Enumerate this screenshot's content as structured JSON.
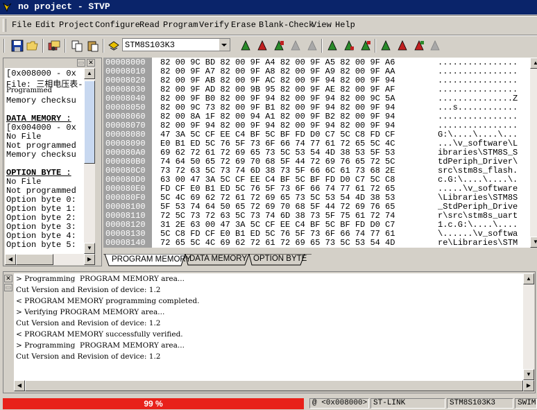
{
  "window": {
    "title": "no project - STVP"
  },
  "menu": [
    "File",
    "Edit",
    "Project",
    "Configure",
    "Read",
    "Program",
    "Verify",
    "Erase",
    "Blank-Check",
    "View",
    "Help"
  ],
  "toolbar": {
    "device": "STM8S103K3"
  },
  "info_panel": {
    "lines": [
      {
        "text": "[0x008000 - 0x",
        "kind": "normal"
      },
      {
        "text": "File: 三相电压表-",
        "kind": "normal"
      },
      {
        "text": "Programmed",
        "kind": "small"
      },
      {
        "text": "Memory checksu",
        "kind": "normal"
      },
      {
        "text": "",
        "kind": "blank"
      },
      {
        "text": "DATA MEMORY :",
        "kind": "header"
      },
      {
        "text": "[0x004000 - 0x",
        "kind": "normal"
      },
      {
        "text": "No File",
        "kind": "normal"
      },
      {
        "text": "Not programmed",
        "kind": "normal"
      },
      {
        "text": "Memory checksu",
        "kind": "normal"
      },
      {
        "text": "",
        "kind": "blank"
      },
      {
        "text": "OPTION BYTE :",
        "kind": "header"
      },
      {
        "text": "No File",
        "kind": "normal"
      },
      {
        "text": "Not programmed",
        "kind": "normal"
      },
      {
        "text": "Option byte 0:",
        "kind": "normal"
      },
      {
        "text": "Option byte 1:",
        "kind": "normal"
      },
      {
        "text": "Option byte 2:",
        "kind": "normal"
      },
      {
        "text": "Option byte 3:",
        "kind": "normal"
      },
      {
        "text": "Option byte 4:",
        "kind": "normal"
      },
      {
        "text": "Option byte 5:",
        "kind": "normal"
      }
    ]
  },
  "memory": {
    "rows": [
      {
        "addr": "00008000",
        "bytes": "82 00 9C BD 82 00 9F A4 82 00 9F A5 82 00 9F A6",
        "ascii": "................"
      },
      {
        "addr": "00008010",
        "bytes": "82 00 9F A7 82 00 9F A8 82 00 9F A9 82 00 9F AA",
        "ascii": "................"
      },
      {
        "addr": "00008020",
        "bytes": "82 00 9F AB 82 00 9F AC 82 00 9F 94 82 00 9F 94",
        "ascii": "................"
      },
      {
        "addr": "00008030",
        "bytes": "82 00 9F AD 82 00 9B 95 82 00 9F AE 82 00 9F AF",
        "ascii": "................"
      },
      {
        "addr": "00008040",
        "bytes": "82 00 9F B0 82 00 9F 94 82 00 9F 94 82 00 9C 5A",
        "ascii": "...............Z"
      },
      {
        "addr": "00008050",
        "bytes": "82 00 9C 73 82 00 9F B1 82 00 9F 94 82 00 9F 94",
        "ascii": "...s............"
      },
      {
        "addr": "00008060",
        "bytes": "82 00 8A 1F 82 00 94 A1 82 00 9F B2 82 00 9F 94",
        "ascii": "................"
      },
      {
        "addr": "00008070",
        "bytes": "82 00 9F 94 82 00 9F 94 82 00 9F 94 82 00 9F 94",
        "ascii": "................"
      },
      {
        "addr": "00008080",
        "bytes": "47 3A 5C CF EE C4 BF 5C BF FD D0 C7 5C C8 FD CF",
        "ascii": "G:\\....\\....\\..."
      },
      {
        "addr": "00008090",
        "bytes": "E0 B1 ED 5C 76 5F 73 6F 66 74 77 61 72 65 5C 4C",
        "ascii": "...\\v_software\\L"
      },
      {
        "addr": "000080A0",
        "bytes": "69 62 72 61 72 69 65 73 5C 53 54 4D 38 53 5F 53",
        "ascii": "ibraries\\STM8S_S"
      },
      {
        "addr": "000080B0",
        "bytes": "74 64 50 65 72 69 70 68 5F 44 72 69 76 65 72 5C",
        "ascii": "tdPeriph_Driver\\"
      },
      {
        "addr": "000080C0",
        "bytes": "73 72 63 5C 73 74 6D 38 73 5F 66 6C 61 73 68 2E",
        "ascii": "src\\stm8s_flash."
      },
      {
        "addr": "000080D0",
        "bytes": "63 00 47 3A 5C CF EE C4 BF 5C BF FD D0 C7 5C C8",
        "ascii": "c.G:\\....\\....\\."
      },
      {
        "addr": "000080E0",
        "bytes": "FD CF E0 B1 ED 5C 76 5F 73 6F 66 74 77 61 72 65",
        "ascii": ".....\\v_software"
      },
      {
        "addr": "000080F0",
        "bytes": "5C 4C 69 62 72 61 72 69 65 73 5C 53 54 4D 38 53",
        "ascii": "\\Libraries\\STM8S"
      },
      {
        "addr": "00008100",
        "bytes": "5F 53 74 64 50 65 72 69 70 68 5F 44 72 69 76 65",
        "ascii": "_StdPeriph_Drive"
      },
      {
        "addr": "00008110",
        "bytes": "72 5C 73 72 63 5C 73 74 6D 38 73 5F 75 61 72 74",
        "ascii": "r\\src\\stm8s_uart"
      },
      {
        "addr": "00008120",
        "bytes": "31 2E 63 00 47 3A 5C CF EE C4 BF 5C BF FD D0 C7",
        "ascii": "1.c.G:\\....\\...."
      },
      {
        "addr": "00008130",
        "bytes": "5C C8 FD CF E0 B1 ED 5C 76 5F 73 6F 66 74 77 61",
        "ascii": "\\......\\v_softwa"
      },
      {
        "addr": "00008140",
        "bytes": "72 65 5C 4C 69 62 72 61 72 69 65 73 5C 53 54 4D",
        "ascii": "re\\Libraries\\STM"
      }
    ]
  },
  "tabs": [
    "PROGRAM MEMORY",
    "DATA MEMORY",
    "OPTION BYTE"
  ],
  "log": [
    "> Programming  PROGRAM MEMORY area...",
    "Cut Version and Revision of device: 1.2",
    "< PROGRAM MEMORY programming completed.",
    "> Verifying PROGRAM MEMORY area...",
    "Cut Version and Revision of device: 1.2",
    "< PROGRAM MEMORY successfully verified.",
    "> Programming  PROGRAM MEMORY area...",
    "Cut Version and Revision of device: 1.2"
  ],
  "status": {
    "progress": 99,
    "progress_label": "99 %",
    "address": "@ <0x008000>",
    "tool": "ST-LINK",
    "device": "STM8S103K3",
    "protocol": "SWIM"
  },
  "colors": {
    "titlebar": "#0a246a",
    "progress": "#e8211a",
    "address_column": "#a0a0a0"
  }
}
